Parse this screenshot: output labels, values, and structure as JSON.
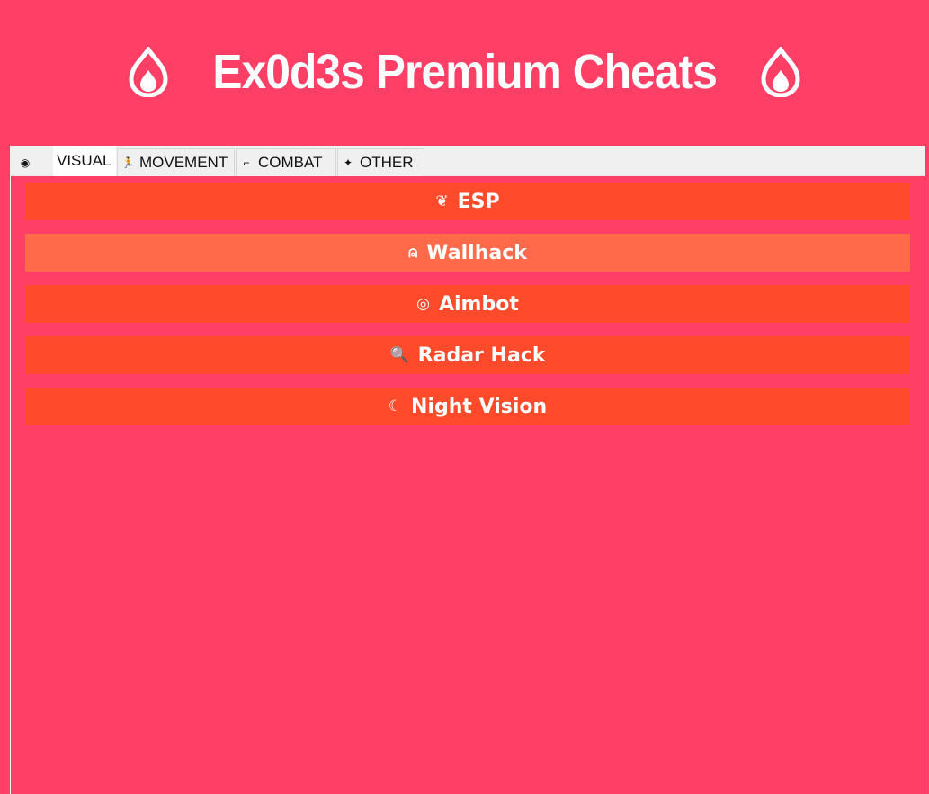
{
  "header": {
    "title": "Ex0d3s Premium Cheats",
    "left_icon": "flame-icon",
    "right_icon": "flame-icon"
  },
  "tabs": [
    {
      "icon": "eye-icon",
      "glyph": "◉",
      "label": ""
    },
    {
      "icon": "",
      "glyph": "",
      "label": "VISUAL"
    },
    {
      "icon": "runner-icon",
      "glyph": "🏃",
      "label": "MOVEMENT"
    },
    {
      "icon": "gun-icon",
      "glyph": "⌐",
      "label": "COMBAT"
    },
    {
      "icon": "sparkle-icon",
      "glyph": "✦",
      "label": "OTHER"
    }
  ],
  "active_tab": "VISUAL",
  "buttons": [
    {
      "label": "ESP",
      "icon": "feather-icon",
      "glyph": "❦"
    },
    {
      "label": "Wallhack",
      "icon": "ghost-icon",
      "glyph": "⍝"
    },
    {
      "label": "Aimbot",
      "icon": "target-icon",
      "glyph": "◎"
    },
    {
      "label": "Radar Hack",
      "icon": "magnifier-icon",
      "glyph": "🔍"
    },
    {
      "label": "Night Vision",
      "icon": "moon-icon",
      "glyph": "☾"
    }
  ],
  "colors": {
    "background": "#ff3f66",
    "button": "#ff4b2b",
    "button_hover": "#ff6a4a",
    "text": "#ffffff"
  }
}
